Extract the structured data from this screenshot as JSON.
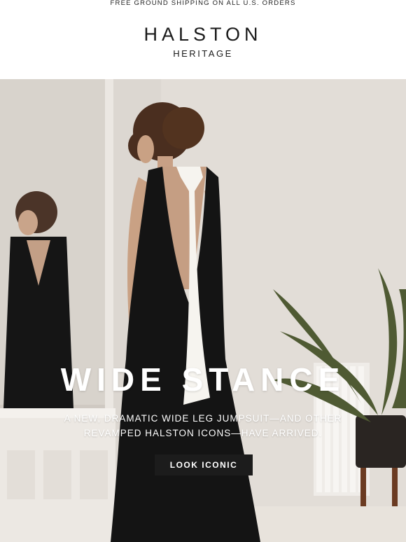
{
  "topbar": {
    "promo": "FREE GROUND SHIPPING ON ALL U.S. ORDERS"
  },
  "brand": {
    "name": "HALSTON",
    "sub": "HERITAGE"
  },
  "hero": {
    "title": "WIDE STANCE",
    "subtitle_line1": "A NEW, DRAMATIC WIDE LEG JUMPSUIT—AND OTHER",
    "subtitle_line2": "REVAMPED HALSTON ICONS—HAVE ARRIVED.",
    "cta_label": "LOOK ICONIC"
  }
}
